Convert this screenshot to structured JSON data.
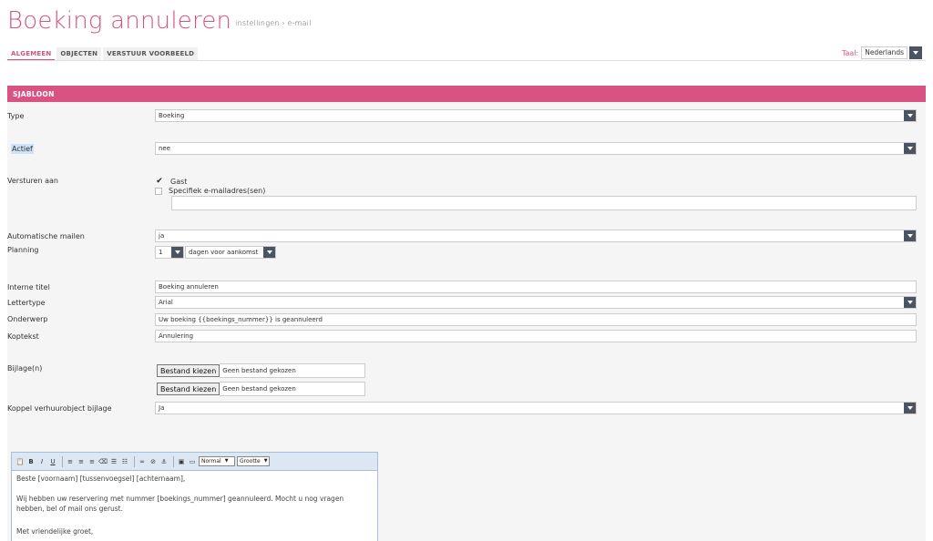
{
  "header": {
    "title": "Boeking annuleren",
    "breadcrumb": "instellingen › e-mail"
  },
  "tabs": [
    {
      "label": "ALGEMEEN",
      "active": true
    },
    {
      "label": "OBJECTEN",
      "active": false
    },
    {
      "label": "VERSTUUR VOORBEELD",
      "active": false
    }
  ],
  "language": {
    "label": "Taal:",
    "value": "Nederlands"
  },
  "panel": {
    "title": "SJABLOON"
  },
  "form": {
    "type": {
      "label": "Type",
      "value": "Boeking"
    },
    "active": {
      "label": "Actief",
      "value": "nee"
    },
    "send_to": {
      "label": "Versturen aan",
      "guest": {
        "label": "Gast",
        "checked": true
      },
      "specific": {
        "label": "Specifiek e-mailadres(sen)",
        "checked": false
      },
      "email_value": ""
    },
    "auto_mail": {
      "label": "Automatische mailen",
      "value": "ja"
    },
    "planning": {
      "label": "Planning",
      "days": "1",
      "when": "dagen voor aankomst"
    },
    "internal_title": {
      "label": "Interne titel",
      "value": "Boeking annuleren"
    },
    "font": {
      "label": "Lettertype",
      "value": "Arial"
    },
    "subject": {
      "label": "Onderwerp",
      "value": "Uw boeking {{boekings_nummer}} is geannuleerd"
    },
    "header_text": {
      "label": "Koptekst",
      "value": "Annulering"
    },
    "attachments": {
      "label": "Bijlage(n)",
      "button": "Bestand kiezen",
      "none": "Geen bestand gekozen"
    },
    "link_object": {
      "label": "Koppel verhuurobject bijlage",
      "value": "Ja"
    }
  },
  "editor": {
    "format": "Normal",
    "size": "Grootte",
    "line1": "Beste [voornaam] [tussenvoegsel] [achternaam],",
    "line2": "Wij hebben uw reservering met nummer [boekings_nummer] geannuleerd. Mocht u nog vragen hebben, bel of mail ons gerust.",
    "line3": "Met vriendelijke groet,"
  }
}
